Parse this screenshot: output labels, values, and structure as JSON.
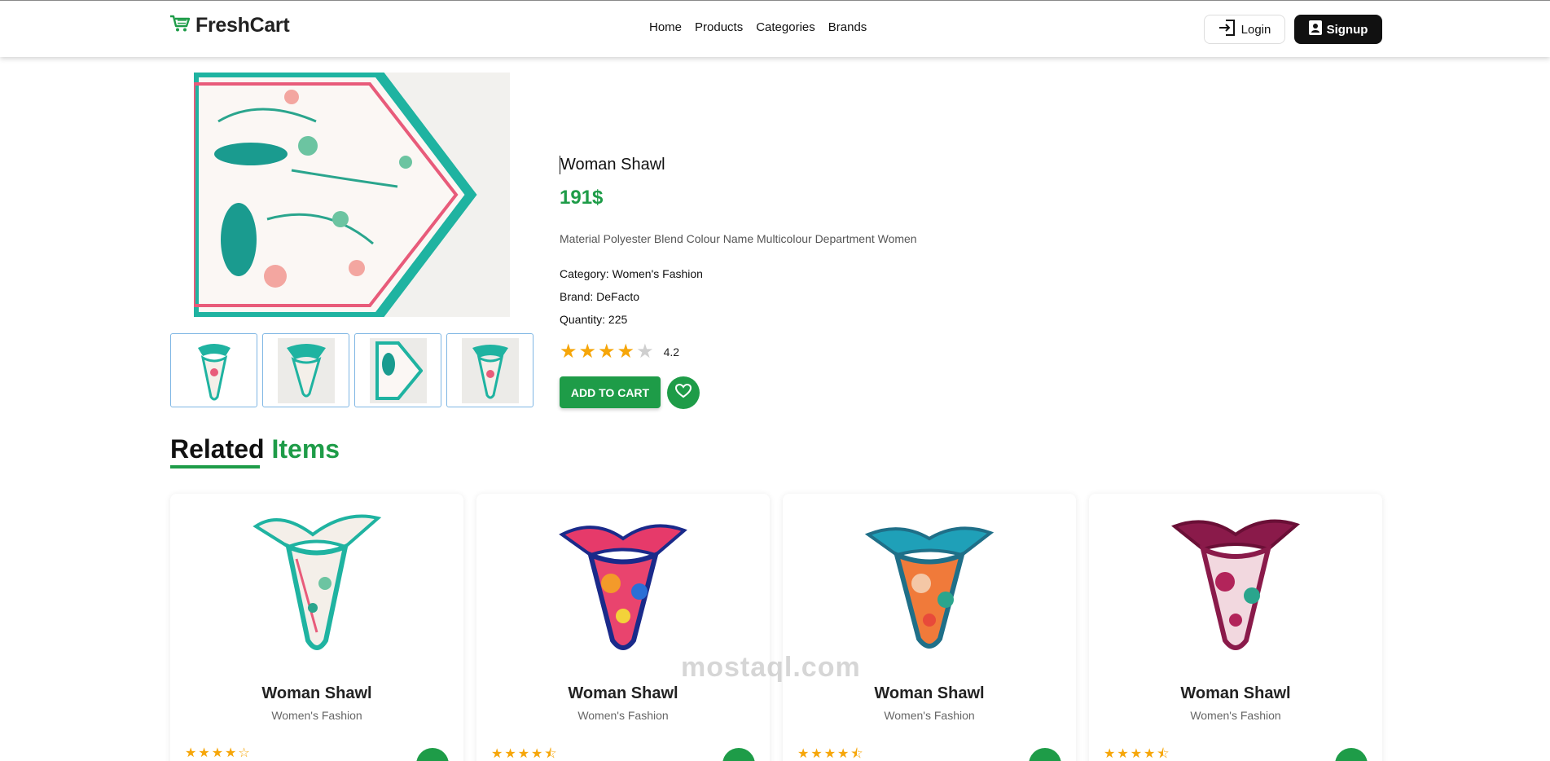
{
  "nav": {
    "brand": "FreshCart",
    "links": [
      "Home",
      "Products",
      "Categories",
      "Brands"
    ],
    "login_label": "Login",
    "signup_label": "Signup"
  },
  "product": {
    "title": "Woman Shawl",
    "price": "191$",
    "description": "Material Polyester Blend Colour Name Multicolour Department Women",
    "category_label": "Category:",
    "category": "Women's Fashion",
    "brand_label": "Brand:",
    "brand": "DeFacto",
    "quantity_label": "Quantity:",
    "quantity": "225",
    "rating": "4.2",
    "stars_filled": 4,
    "stars_total": 5,
    "add_to_cart": "ADD TO CART",
    "thumbnail_count": 4
  },
  "related": {
    "heading_word1": "Related",
    "heading_word2": "Items",
    "items": [
      {
        "title": "Woman Shawl",
        "category": "Women's Fashion",
        "stars": "★★★★☆"
      },
      {
        "title": "Woman Shawl",
        "category": "Women's Fashion",
        "stars": "★★★★⯪"
      },
      {
        "title": "Woman Shawl",
        "category": "Women's Fashion",
        "stars": "★★★★⯪"
      },
      {
        "title": "Woman Shawl",
        "category": "Women's Fashion",
        "stars": "★★★★⯪"
      }
    ]
  },
  "watermark": {
    "text": "mostaql.com"
  },
  "colors": {
    "accent": "#1e9c48",
    "star": "#f6a609",
    "dark": "#111111"
  }
}
